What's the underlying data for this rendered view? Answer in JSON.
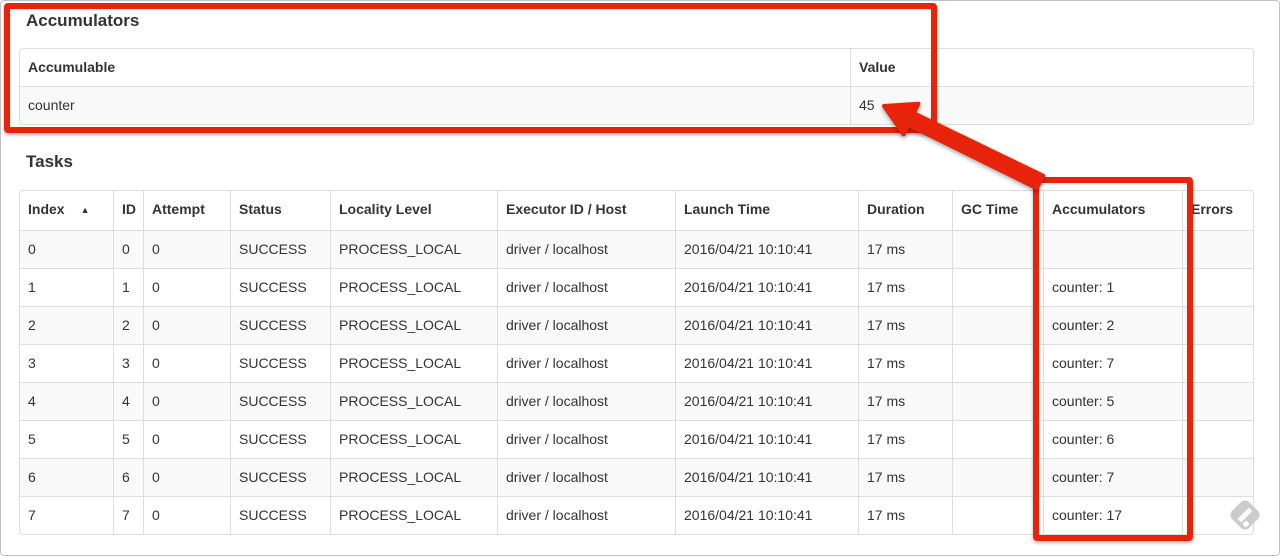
{
  "accumulators_section": {
    "title": "Accumulators",
    "table": {
      "headers": [
        "Accumulable",
        "Value"
      ],
      "rows": [
        [
          "counter",
          "45"
        ]
      ]
    }
  },
  "tasks_section": {
    "title": "Tasks",
    "table": {
      "headers": [
        "Index",
        "ID",
        "Attempt",
        "Status",
        "Locality Level",
        "Executor ID / Host",
        "Launch Time",
        "Duration",
        "GC Time",
        "Accumulators",
        "Errors"
      ],
      "sort": {
        "column": "Index",
        "direction": "ascending",
        "indicator": "▲"
      },
      "rows": [
        [
          "0",
          "0",
          "0",
          "SUCCESS",
          "PROCESS_LOCAL",
          "driver / localhost",
          "2016/04/21 10:10:41",
          "17 ms",
          "",
          "",
          ""
        ],
        [
          "1",
          "1",
          "0",
          "SUCCESS",
          "PROCESS_LOCAL",
          "driver / localhost",
          "2016/04/21 10:10:41",
          "17 ms",
          "",
          "counter: 1",
          ""
        ],
        [
          "2",
          "2",
          "0",
          "SUCCESS",
          "PROCESS_LOCAL",
          "driver / localhost",
          "2016/04/21 10:10:41",
          "17 ms",
          "",
          "counter: 2",
          ""
        ],
        [
          "3",
          "3",
          "0",
          "SUCCESS",
          "PROCESS_LOCAL",
          "driver / localhost",
          "2016/04/21 10:10:41",
          "17 ms",
          "",
          "counter: 7",
          ""
        ],
        [
          "4",
          "4",
          "0",
          "SUCCESS",
          "PROCESS_LOCAL",
          "driver / localhost",
          "2016/04/21 10:10:41",
          "17 ms",
          "",
          "counter: 5",
          ""
        ],
        [
          "5",
          "5",
          "0",
          "SUCCESS",
          "PROCESS_LOCAL",
          "driver / localhost",
          "2016/04/21 10:10:41",
          "17 ms",
          "",
          "counter: 6",
          ""
        ],
        [
          "6",
          "6",
          "0",
          "SUCCESS",
          "PROCESS_LOCAL",
          "driver / localhost",
          "2016/04/21 10:10:41",
          "17 ms",
          "",
          "counter: 7",
          ""
        ],
        [
          "7",
          "7",
          "0",
          "SUCCESS",
          "PROCESS_LOCAL",
          "driver / localhost",
          "2016/04/21 10:10:41",
          "17 ms",
          "",
          "counter: 17",
          ""
        ]
      ]
    }
  },
  "annotations": {
    "color": "#e8230c"
  },
  "watermark_color": "#cbcbcb"
}
